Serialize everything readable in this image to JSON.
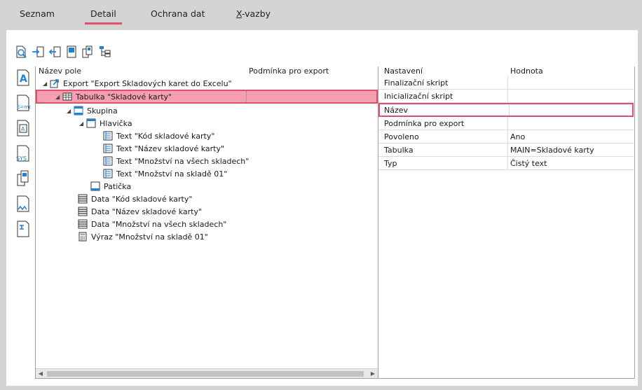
{
  "tabs": [
    {
      "pre": "Se",
      "u": "",
      "post": "znam",
      "label": "Seznam"
    },
    {
      "pre": "",
      "u": "",
      "post": "Detail",
      "label": "Detail"
    },
    {
      "pre": "",
      "u": "",
      "post": "Ochrana dat",
      "label": "Ochrana dat"
    },
    {
      "pre": "",
      "u": "X",
      "post": "-vazby",
      "label": "X-vazby"
    }
  ],
  "toolbar_icons": [
    "preview-icon",
    "insert-field-icon",
    "remove-field-icon",
    "page-icon",
    "copy-pages-icon",
    "structure-icon"
  ],
  "sidebar_icons": [
    "text-field-icon",
    "formula-icon",
    "variable-icon",
    "system-variable-icon",
    "copy-field-icon",
    "table-field-icon",
    "export-field-icon"
  ],
  "tree": {
    "col_name": "Název pole",
    "col_condition": "Podmínka pro export",
    "rows": [
      {
        "label": "Export \"Export Skladových karet do Excelu\"",
        "icon": "export-icon"
      },
      {
        "label": "Tabulka \"Skladové karty\"",
        "icon": "table-icon"
      },
      {
        "label": "Skupina",
        "icon": "group-icon"
      },
      {
        "label": "Hlavička",
        "icon": "header-icon"
      },
      {
        "label": "Text \"Kód skladové karty\"",
        "icon": "text-icon"
      },
      {
        "label": "Text \"Název skladové karty\"",
        "icon": "text-icon"
      },
      {
        "label": "Text \"Množství na všech skladech\"",
        "icon": "text-icon"
      },
      {
        "label": "Text \"Množství na skladě 01\"",
        "icon": "text-icon"
      },
      {
        "label": "Patička",
        "icon": "footer-icon"
      },
      {
        "label": "Data \"Kód skladové karty\"",
        "icon": "data-icon"
      },
      {
        "label": "Data \"Název skladové karty\"",
        "icon": "data-icon"
      },
      {
        "label": "Data \"Množství na všech skladech\"",
        "icon": "data-icon"
      },
      {
        "label": "Výraz \"Množství na skladě 01\"",
        "icon": "expression-icon"
      }
    ]
  },
  "props": {
    "col_setting": "Nastavení",
    "col_value": "Hodnota",
    "rows": [
      {
        "name": "Finalizační skript",
        "value": ""
      },
      {
        "name": "Inicializační skript",
        "value": ""
      },
      {
        "name": "Název",
        "value": ""
      },
      {
        "name": "Podmínka pro export",
        "value": ""
      },
      {
        "name": "Povoleno",
        "value": "Ano"
      },
      {
        "name": "Tabulka",
        "value": "MAIN=Skladové karty"
      },
      {
        "name": "Typ",
        "value": "Čistý text"
      }
    ]
  },
  "colors": {
    "accent": "#e0506e",
    "selection": "#f4a0b1",
    "icon_blue": "#1f7fd0"
  }
}
